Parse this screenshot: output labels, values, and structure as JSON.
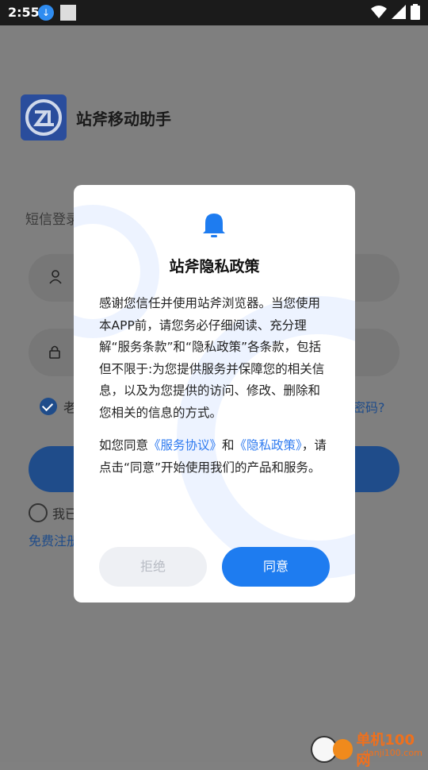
{
  "status_bar": {
    "time": "2:55",
    "icons": [
      "download-icon",
      "app-notification-icon",
      "wifi-icon",
      "signal-icon",
      "battery-icon"
    ]
  },
  "background_page": {
    "app_name": "站斧移动助手",
    "sms_login_label": "短信登录",
    "remember_label": "老",
    "forgot_password_label": "密码?",
    "agree_label": "我已",
    "register_label": "免费注册"
  },
  "dialog": {
    "title": "站斧隐私政策",
    "para1": "感谢您信任并使用站斧浏览器。当您使用本APP前，请您务必仔细阅读、充分理解“服务条款”和“隐私政策”各条款，包括但不限于:为您提供服务并保障您的相关信息，以及为您提供的访问、修改、删除和您相关的信息的方式。",
    "para2_prefix": "如您同意",
    "service_link": "《服务协议》",
    "para2_and": "和",
    "privacy_link": "《隐私政策》",
    "para2_suffix": "，请点击“同意”开始使用我们的产品和服务。",
    "refuse_button": "拒绝",
    "agree_button": "同意"
  },
  "watermark": {
    "brand": "单机100网",
    "url": "danji100.com"
  },
  "colors": {
    "primary": "#1e7cf0",
    "link": "#2f7bf0",
    "refuse_bg": "#eef0f4",
    "overlay": "#808080"
  }
}
